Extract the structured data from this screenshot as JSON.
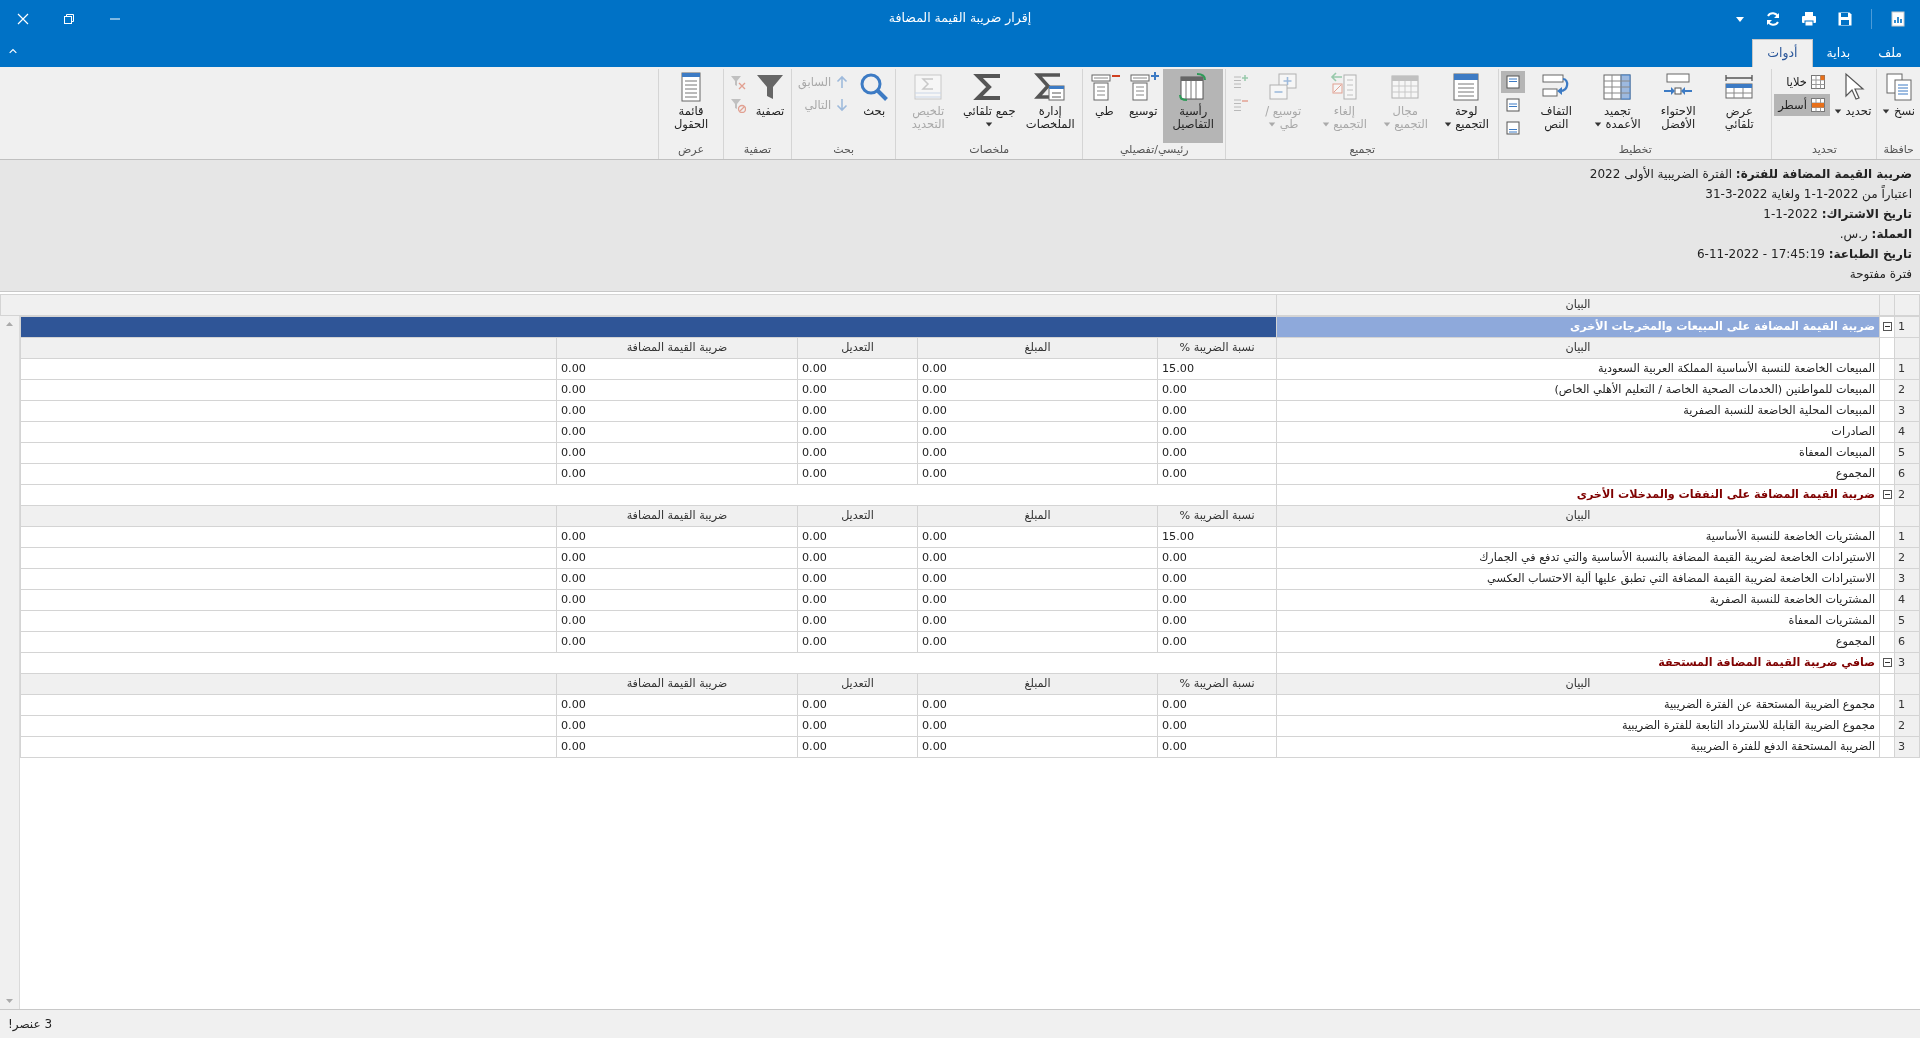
{
  "window": {
    "title": "إقرار ضريبة القيمة المضافة"
  },
  "tabs": [
    {
      "label": "ملف",
      "selected": false
    },
    {
      "label": "بداية",
      "selected": false
    },
    {
      "label": "أدوات",
      "selected": true
    }
  ],
  "ribbon_groups": [
    {
      "label": "حافظة",
      "items": [
        {
          "kind": "large",
          "label": "نسخ",
          "selected": false,
          "disabled": false,
          "dropdown": true
        }
      ]
    },
    {
      "label": "تحديد",
      "items": [
        {
          "kind": "large",
          "label": "تحديد",
          "selected": false,
          "disabled": false,
          "dropdown": true
        },
        {
          "kind": "stack",
          "buttons": [
            {
              "kind": "small",
              "label": "خلايا",
              "selected": false,
              "disabled": false
            },
            {
              "kind": "small",
              "label": "أسطر",
              "selected": true,
              "disabled": false
            }
          ]
        }
      ]
    },
    {
      "label": "تخطيط",
      "items": [
        {
          "kind": "large",
          "label": "عرض تلقائي",
          "selected": false,
          "disabled": false,
          "dropdown": false
        },
        {
          "kind": "large",
          "label": "الاحتواء الأفضل",
          "selected": false,
          "disabled": false,
          "dropdown": false
        },
        {
          "kind": "large",
          "label": "تجميد الأعمدة",
          "selected": false,
          "disabled": false,
          "dropdown": true
        },
        {
          "kind": "large",
          "label": "التفاف النص",
          "selected": false,
          "disabled": false,
          "dropdown": false
        },
        {
          "kind": "stack",
          "buttons": [
            {
              "kind": "icon",
              "selected": true,
              "disabled": false
            },
            {
              "kind": "icon",
              "selected": false,
              "disabled": false
            },
            {
              "kind": "icon",
              "selected": false,
              "disabled": false
            }
          ]
        }
      ]
    },
    {
      "label": "تجميع",
      "items": [
        {
          "kind": "large",
          "label": "لوحة التجميع",
          "selected": false,
          "disabled": false,
          "dropdown": true
        },
        {
          "kind": "large",
          "label": "مجال التجميع",
          "selected": false,
          "disabled": true,
          "dropdown": true
        },
        {
          "kind": "large",
          "label": "إلغاء التجميع",
          "selected": false,
          "disabled": true,
          "dropdown": true
        },
        {
          "kind": "large",
          "label": "توسيع / طي",
          "selected": false,
          "disabled": true,
          "dropdown": true
        },
        {
          "kind": "stack",
          "buttons": [
            {
              "kind": "icon",
              "selected": false,
              "disabled": true
            },
            {
              "kind": "icon",
              "selected": false,
              "disabled": true
            }
          ]
        }
      ]
    },
    {
      "label": "رئيسي/تفصيلي",
      "items": [
        {
          "kind": "large",
          "label": "رأسية التفاصيل",
          "selected": true,
          "disabled": false,
          "dropdown": false
        },
        {
          "kind": "large",
          "label": "توسيع",
          "selected": false,
          "disabled": false,
          "dropdown": false
        },
        {
          "kind": "large",
          "label": "طي",
          "selected": false,
          "disabled": false,
          "dropdown": false
        }
      ]
    },
    {
      "label": "ملخصات",
      "items": [
        {
          "kind": "large",
          "label": "إدارة الملخصات",
          "selected": false,
          "disabled": false,
          "dropdown": false
        },
        {
          "kind": "large",
          "label": "جمع تلقائي",
          "selected": false,
          "disabled": false,
          "dropdown": true
        },
        {
          "kind": "large",
          "label": "تلخيص التحديد",
          "selected": false,
          "disabled": true,
          "dropdown": false
        }
      ]
    },
    {
      "label": "بحث",
      "items": [
        {
          "kind": "large",
          "label": "بحث",
          "selected": false,
          "disabled": false,
          "dropdown": false
        },
        {
          "kind": "stack",
          "buttons": [
            {
              "kind": "small",
              "label": "السابق",
              "selected": false,
              "disabled": true
            },
            {
              "kind": "small",
              "label": "التالي",
              "selected": false,
              "disabled": true
            }
          ]
        }
      ]
    },
    {
      "label": "تصفية",
      "items": [
        {
          "kind": "large",
          "label": "تصفية",
          "selected": false,
          "disabled": false,
          "dropdown": false
        },
        {
          "kind": "stack",
          "buttons": [
            {
              "kind": "icon",
              "selected": false,
              "disabled": true
            },
            {
              "kind": "icon",
              "selected": false,
              "disabled": true
            }
          ]
        }
      ]
    },
    {
      "label": "عرض",
      "items": [
        {
          "kind": "large",
          "label": "قائمة الحقول",
          "selected": false,
          "disabled": false,
          "dropdown": false
        }
      ]
    }
  ],
  "report_info": [
    "**ضريبة القيمة المضافة للفترة:** الفترة الضريبية الأولى 2022",
    "اعتباراً من  2022-1-1 ولغاية  2022-3-31",
    "**تاريخ الاشتراك:** 2022-1-1",
    "**العملة:** ر.س.",
    "**تاريخ الطباعة:** 17:45:19 - 2022-11-6",
    "فترة مفتوحة"
  ],
  "grid": {
    "header": "البيان",
    "sections": [
      {
        "number": "1",
        "title": "ضريبة القيمة المضافة على المبيعات والمخرجات الأخرى",
        "selected": true,
        "expanded": true,
        "columns": [
          "البيان",
          "نسبة الضريبة %",
          "المبلغ",
          "التعديل",
          "ضريبة القيمة المضافة"
        ],
        "rows": [
          {
            "number": "1",
            "cells": [
              "المبيعات الخاضعة للنسبة الأساسية المملكة العربية السعودية",
              "15.00",
              "0.00",
              "0.00",
              "0.00"
            ]
          },
          {
            "number": "2",
            "cells": [
              "المبيعات للمواطنين (الخدمات الصحية الخاصة / التعليم الأهلي الخاص)",
              "0.00",
              "0.00",
              "0.00",
              "0.00"
            ]
          },
          {
            "number": "3",
            "cells": [
              "المبيعات المحلية الخاضعة للنسبة الصفرية",
              "0.00",
              "0.00",
              "0.00",
              "0.00"
            ]
          },
          {
            "number": "4",
            "cells": [
              "الصادرات",
              "0.00",
              "0.00",
              "0.00",
              "0.00"
            ]
          },
          {
            "number": "5",
            "cells": [
              "المبيعات المعفاة",
              "0.00",
              "0.00",
              "0.00",
              "0.00"
            ]
          },
          {
            "number": "6",
            "cells": [
              "المجموع",
              "0.00",
              "0.00",
              "0.00",
              "0.00"
            ]
          }
        ]
      },
      {
        "number": "2",
        "title": "ضريبة القيمة المضافة على النفقات والمدخلات الأخرى",
        "selected": false,
        "expanded": true,
        "columns": [
          "البيان",
          "نسبة الضريبة %",
          "المبلغ",
          "التعديل",
          "ضريبة القيمة المضافة"
        ],
        "rows": [
          {
            "number": "1",
            "cells": [
              "المشتريات الخاضعة للنسبة الأساسية",
              "15.00",
              "0.00",
              "0.00",
              "0.00"
            ]
          },
          {
            "number": "2",
            "cells": [
              "الاستيرادات الخاضعة لضريبة القيمة المضافة بالنسبة الأساسية والتي تدفع في الجمارك",
              "0.00",
              "0.00",
              "0.00",
              "0.00"
            ]
          },
          {
            "number": "3",
            "cells": [
              "الاستيرادات الخاضعة لضريبة القيمة المضافة التي تطبق عليها ألية الاحتساب العكسي",
              "0.00",
              "0.00",
              "0.00",
              "0.00"
            ]
          },
          {
            "number": "4",
            "cells": [
              "المشتريات الخاضعة للنسبة الصفرية",
              "0.00",
              "0.00",
              "0.00",
              "0.00"
            ]
          },
          {
            "number": "5",
            "cells": [
              "المشتريات المعفاة",
              "0.00",
              "0.00",
              "0.00",
              "0.00"
            ]
          },
          {
            "number": "6",
            "cells": [
              "المجموع",
              "0.00",
              "0.00",
              "0.00",
              "0.00"
            ]
          }
        ]
      },
      {
        "number": "3",
        "title": "صافي ضريبة القيمة المضافة المستحقة",
        "selected": false,
        "expanded": true,
        "columns": [
          "البيان",
          "نسبة الضريبة %",
          "المبلغ",
          "التعديل",
          "ضريبة القيمة المضافة"
        ],
        "rows": [
          {
            "number": "1",
            "cells": [
              "مجموع الضريبة المستحقة عن الفترة الضريبية",
              "0.00",
              "0.00",
              "0.00",
              "0.00"
            ]
          },
          {
            "number": "2",
            "cells": [
              "مجموع الضريبة القابلة للاسترداد التابعة للفترة الضريبية",
              "0.00",
              "0.00",
              "0.00",
              "0.00"
            ]
          },
          {
            "number": "3",
            "cells": [
              "الضريبة المستحقة الدفع للفترة الضريبية",
              "0.00",
              "0.00",
              "0.00",
              "0.00"
            ]
          }
        ]
      }
    ]
  },
  "status_bar": {
    "text": "3 عنصر!"
  }
}
